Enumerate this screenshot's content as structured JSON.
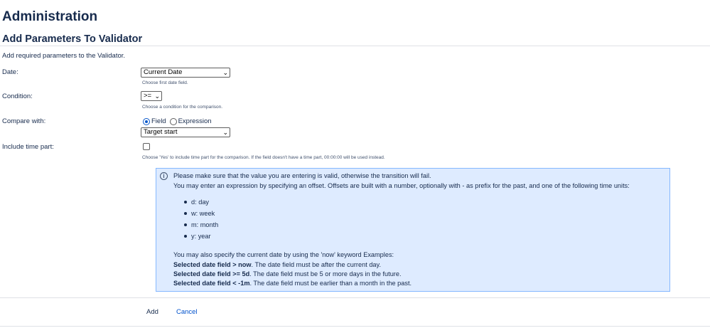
{
  "page_title": "Administration",
  "section_title": "Add Parameters To Validator",
  "intro": "Add required parameters to the Validator.",
  "fields": {
    "date": {
      "label": "Date:",
      "value": "Current Date",
      "hint": "Choose first date field."
    },
    "condition": {
      "label": "Condition:",
      "value": ">=",
      "hint": "Choose a condition for the comparison."
    },
    "compare_with": {
      "label": "Compare with:",
      "options": [
        "Field",
        "Expression"
      ],
      "selected": "Field",
      "value": "Target start"
    },
    "include_time": {
      "label": "Include time part:",
      "checked": false,
      "hint": "Choose 'Yes' to include time part for the comparison. If the field doesn't have a time part, 00:00:00 will be used instead."
    }
  },
  "info": {
    "line1": "Please make sure that the value you are entering is valid, otherwise the transition will fail.",
    "line2": "You may enter an expression by specifying an offset. Offsets are built with a number, optionally with - as prefix for the past, and one of the following time units:",
    "units": [
      "d: day",
      "w: week",
      "m: month",
      "y: year"
    ],
    "line3": "You may also specify the current date by using the 'now' keyword Examples:",
    "examples": [
      {
        "bold": "Selected date field > now",
        "text": ". The date field must be after the current day."
      },
      {
        "bold": "Selected date field >= 5d",
        "text": ". The date field must be 5 or more days in the future."
      },
      {
        "bold": "Selected date field < -1m",
        "text": ". The date field must be earlier than a month in the past."
      }
    ]
  },
  "buttons": {
    "add": "Add",
    "cancel": "Cancel"
  },
  "colors": {
    "info_bg": "#deebff",
    "info_border": "#85b8ff",
    "link": "#0052cc",
    "text": "#172b4d"
  }
}
